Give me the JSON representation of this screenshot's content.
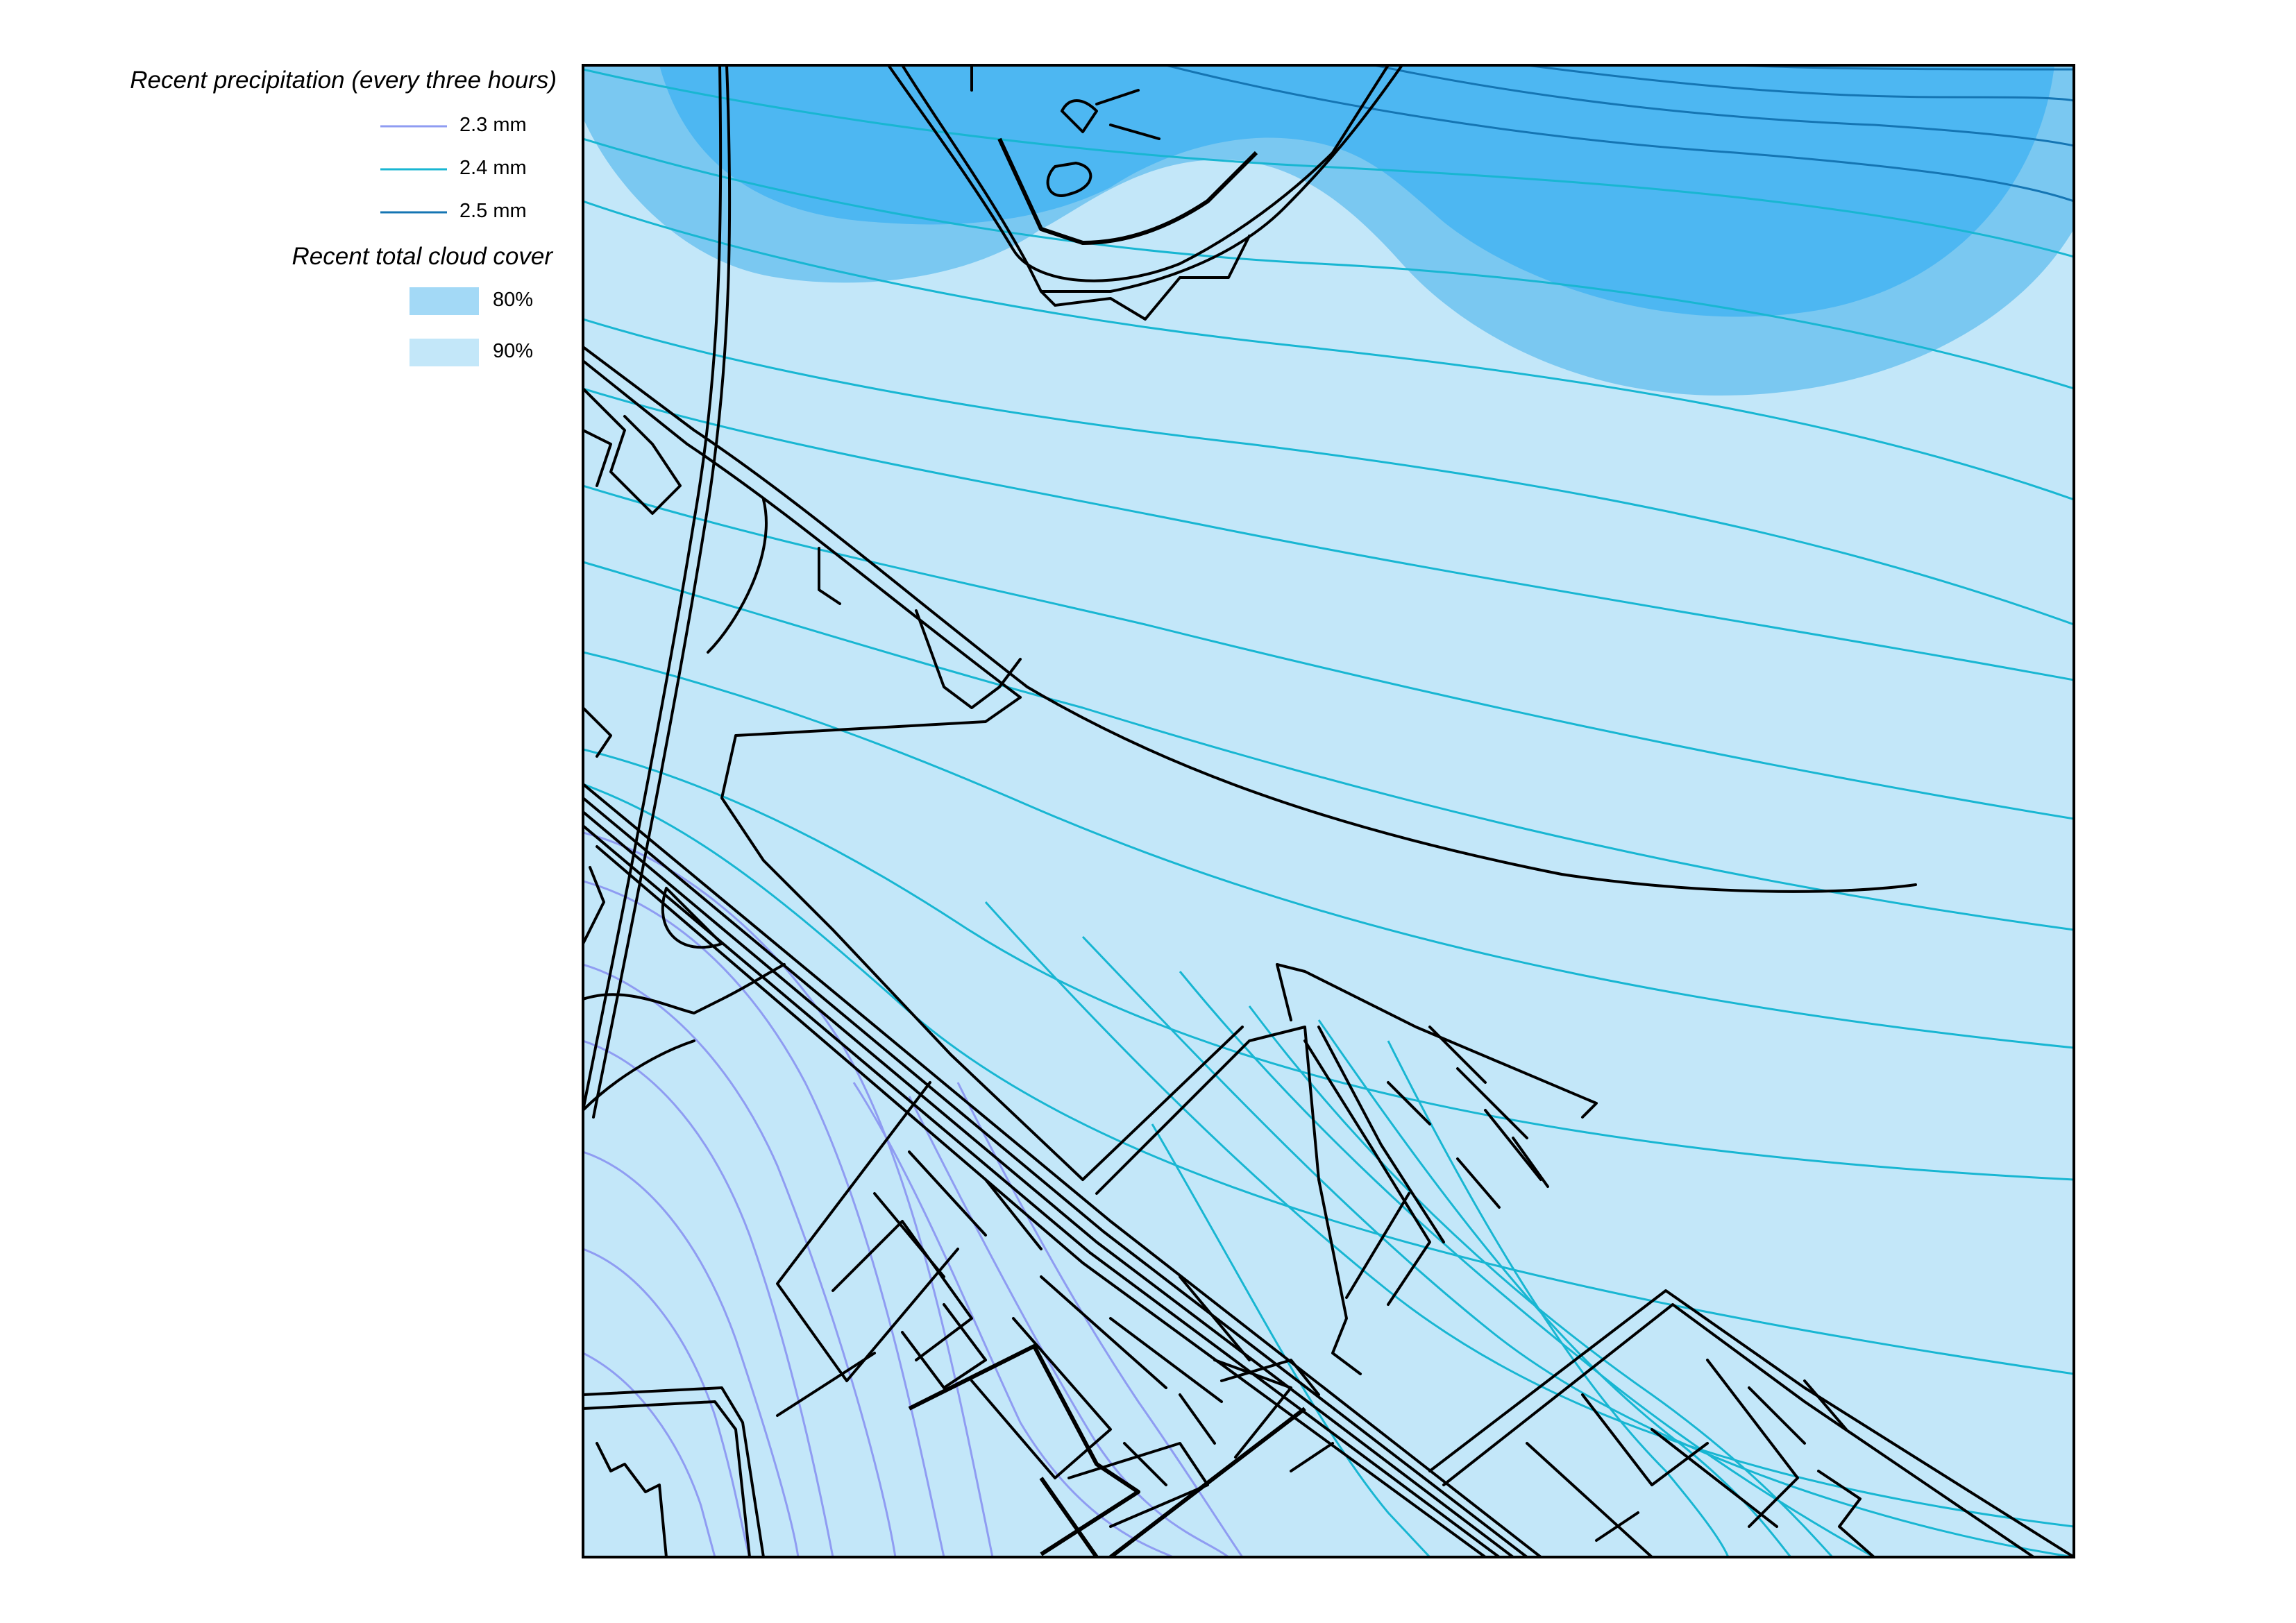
{
  "legend": {
    "precip_title": "Recent precipitation (every three hours)",
    "precip_items": [
      {
        "label": "2.3 mm",
        "color": "#8f9cf2"
      },
      {
        "label": "2.4 mm",
        "color": "#18b6d2"
      },
      {
        "label": "2.5 mm",
        "color": "#1575b3"
      }
    ],
    "cloud_title": "Recent total cloud cover",
    "cloud_items": [
      {
        "label": "80%",
        "color": "#a3d9f6"
      },
      {
        "label": "90%",
        "color": "#c3e7f9"
      }
    ]
  },
  "map": {
    "cloud_fills": {
      "base": "#c3e7f9",
      "level_80": "#7ac8f1",
      "level_70": "#4db7f2"
    },
    "contour_colors": {
      "mm_2_3": "#8f9cf2",
      "mm_2_4": "#18b6d2",
      "mm_2_5": "#1575b3"
    }
  }
}
